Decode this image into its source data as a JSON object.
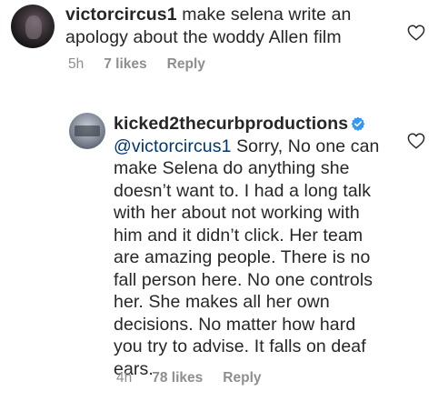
{
  "comments": [
    {
      "username": "victorcircus1",
      "text": " make selena write an apology about the woddy Allen film",
      "time": "5h",
      "likes": "7 likes",
      "reply": "Reply"
    },
    {
      "username": "kicked2thecurbproductions",
      "verified": true,
      "mention": "@victorcircus1",
      "text": " Sorry, No one can make Selena do anything she doesn’t want to. I had a long talk with her about not working with him and it didn’t click. Her team are amazing people. There is no fall person here. No one controls her. She makes all her own decisions. No matter how hard you try to advise. It falls on deaf ears.",
      "time": "4h",
      "likes": "78 likes",
      "reply": "Reply"
    }
  ],
  "colors": {
    "text": "#262626",
    "meta": "#8e8e8e",
    "mention": "#00376b",
    "verified": "#3897f0"
  },
  "icons": {
    "like": "heart-outline-icon",
    "verified": "verified-badge-icon"
  }
}
